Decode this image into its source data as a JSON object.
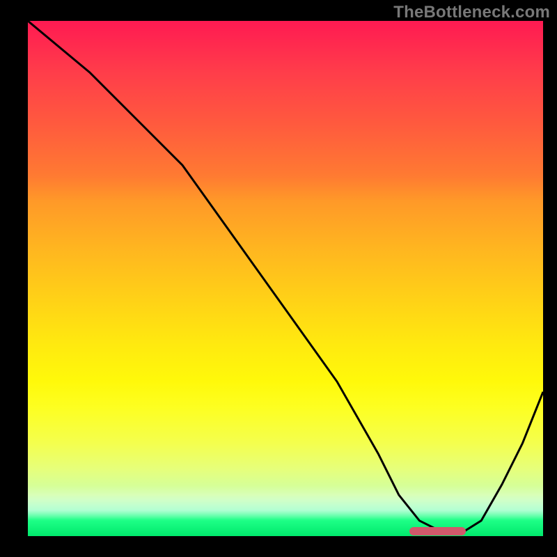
{
  "watermark": "TheBottleneck.com",
  "chart_data": {
    "type": "line",
    "title": "",
    "xlabel": "",
    "ylabel": "",
    "xlim": [
      0,
      100
    ],
    "ylim": [
      0,
      100
    ],
    "grid": false,
    "series": [
      {
        "name": "curve",
        "x": [
          0,
          12,
          22,
          30,
          40,
          50,
          60,
          68,
          72,
          76,
          80,
          84,
          88,
          92,
          96,
          100
        ],
        "y": [
          102,
          90,
          80,
          72,
          58,
          44,
          30,
          16,
          8,
          3,
          1,
          0.5,
          3,
          10,
          18,
          28
        ]
      }
    ],
    "marker": {
      "x_start": 74,
      "x_end": 85,
      "y": 1
    },
    "gradient_stops": [
      {
        "pos": 0,
        "color": "#ff1a52"
      },
      {
        "pos": 35,
        "color": "#ff9928"
      },
      {
        "pos": 70,
        "color": "#fff90a"
      },
      {
        "pos": 100,
        "color": "#00e96c"
      }
    ]
  }
}
